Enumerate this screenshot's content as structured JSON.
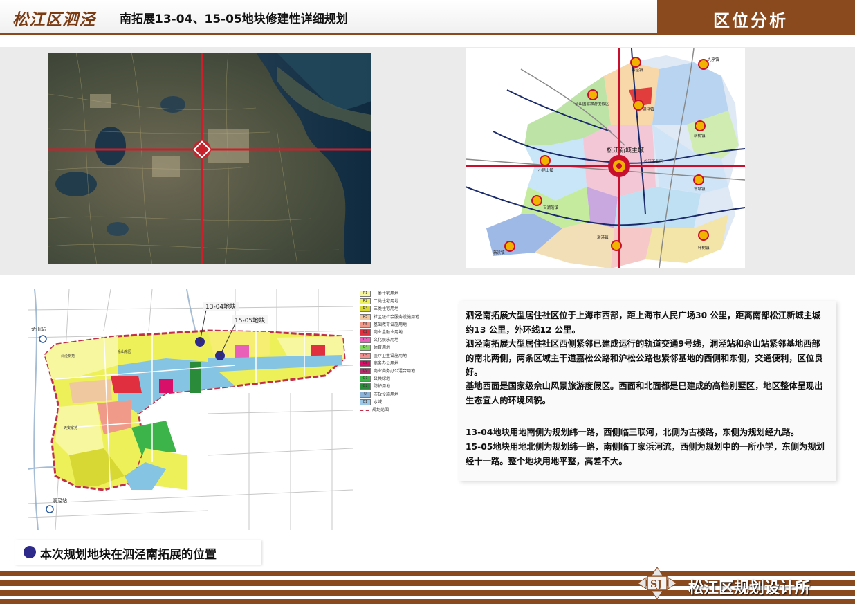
{
  "header": {
    "title_main": "松江区泗泾",
    "title_sub": "南拓展13-04、15-05地块修建性详细规划",
    "section_label": "区位分析"
  },
  "district_map": {
    "center_label": "松江新城主城",
    "town_labels": [
      "泗泾镇",
      "九亭镇",
      "佘山国家旅游度假区",
      "洞泾镇",
      "新桥镇",
      "小昆山镇",
      "松江工业区",
      "车墩镇",
      "石湖荡镇",
      "泖港镇",
      "新浜镇",
      "叶榭镇"
    ]
  },
  "landuse_map": {
    "callout_1304": "13-04地块",
    "callout_1505": "15-05地块",
    "station_north": "佘山站",
    "station_south": "洞泾站",
    "block_labels": [
      "洞泾新苑",
      "佘山东园",
      "天安家苑"
    ]
  },
  "legend": [
    {
      "code": "R1",
      "label": "一类住宅用地",
      "color": "#f7f7a0"
    },
    {
      "code": "R2",
      "label": "二类住宅用地",
      "color": "#eef05a"
    },
    {
      "code": "R3",
      "label": "三类住宅用地",
      "color": "#d8d834"
    },
    {
      "code": "R5",
      "label": "社区级社会服务设施用地",
      "color": "#f0c8a0"
    },
    {
      "code": "R5",
      "label": "基础教育设施用地",
      "color": "#f09a8a"
    },
    {
      "code": "C2",
      "label": "商业金融业用地",
      "color": "#e03040"
    },
    {
      "code": "C3",
      "label": "文化娱乐用地",
      "color": "#e860b8"
    },
    {
      "code": "C4",
      "label": "体育用地",
      "color": "#80d860"
    },
    {
      "code": "C5",
      "label": "医疗卫生设施用地",
      "color": "#f09090"
    },
    {
      "code": "C8",
      "label": "商务办公用地",
      "color": "#d8106a"
    },
    {
      "code": "C9",
      "label": "商业商务办公混合用地",
      "color": "#b0306a"
    },
    {
      "code": "G1",
      "label": "公共绿地",
      "color": "#3cb44a"
    },
    {
      "code": "G2",
      "label": "防护用地",
      "color": "#2a8c3a"
    },
    {
      "code": "U",
      "label": "市政设施用地",
      "color": "#8cb4d8"
    },
    {
      "code": "E1",
      "label": "水域",
      "color": "#9cc8e8"
    },
    {
      "code": "",
      "label": "规划范围",
      "color": "#c0304a"
    }
  ],
  "description": {
    "p1": "泗泾南拓展大型居住社区位于上海市西部，距上海市人民广场30 公里，距离南部松江新城主城约13 公里，外环线12 公里。",
    "p2": "泗泾南拓展大型居住社区西侧紧邻已建成运行的轨道交通9号线，洞泾站和佘山站紧邻基地西部的南北两侧，两条区域主干道嘉松公路和沪松公路也紧邻基地的西侧和东侧，交通便利，区位良好。",
    "p3": "基地西面是国家级佘山风景旅游度假区。西面和北面都是已建成的高档别墅区，地区整体呈现出生态宜人的环境风貌。",
    "p4": "13-04地块用地南侧为规划纬一路，西侧临三联河，北侧为古楼路，东侧为规划经九路。",
    "p5": "15-05地块用地北侧为规划纬一路，南侧临丁家浜河流，西侧为规划中的一所小学，东侧为规划经十一路。整个地块用地平整，高差不大。"
  },
  "caption": {
    "text": "本次规划地块在泗泾南拓展的位置",
    "marker_color": "#2e2a8c"
  },
  "footer": {
    "logo_text": "SJ",
    "org_name": "松江区规划设计所"
  },
  "colors": {
    "brand_brown": "#8b4a1e",
    "locator_red": "#c8102e"
  }
}
